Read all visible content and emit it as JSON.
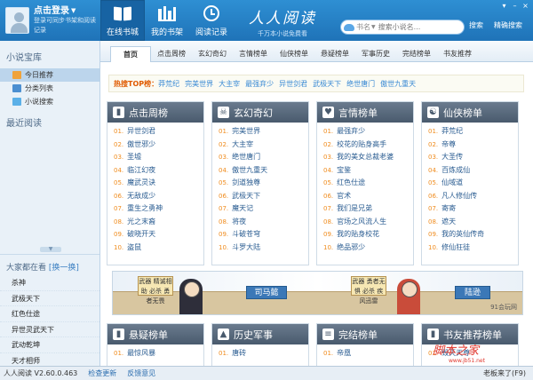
{
  "header": {
    "login": {
      "title": "点击登录",
      "subtitle": "登录可同步书架和阅读记录"
    },
    "tabs": [
      {
        "label": "在线书城",
        "icon": "book-icon"
      },
      {
        "label": "我的书架",
        "icon": "bookshelf-icon"
      },
      {
        "label": "阅读记录",
        "icon": "clock-icon"
      }
    ],
    "brand": {
      "name": "人人阅读",
      "slogan": "千万本小说免费看"
    },
    "search": {
      "category": "书名",
      "placeholder": "搜索小说名...",
      "button": "搜索",
      "precise_button": "精确搜索"
    }
  },
  "sidebar": {
    "title": "小说宝库",
    "menu": [
      {
        "label": "今日推荐"
      },
      {
        "label": "分类列表"
      },
      {
        "label": "小说搜索"
      }
    ],
    "recent_title": "最近阅读",
    "hot_title": "大家都在看",
    "hot_swap": "[换一换]",
    "hot_list": [
      "杀神",
      "武极天下",
      "红色仕途",
      "异世灵武天下",
      "武动乾坤",
      "天才相师"
    ]
  },
  "main": {
    "tabs": [
      "首页",
      "点击周榜",
      "玄幻奇幻",
      "言情榜单",
      "仙侠榜单",
      "悬疑榜单",
      "军事历史",
      "完结榜单",
      "书友推荐"
    ],
    "hot_label": "热搜TOP榜：",
    "hot_links": [
      "莽荒纪",
      "完美世界",
      "大主宰",
      "最强弃少",
      "异世剑君",
      "武极天下",
      "绝世唐门",
      "傲世九重天"
    ],
    "panels": [
      {
        "title": "点击周榜",
        "icon": "bookmark-icon",
        "items": [
          "异世剑君",
          "傲世邪少",
          "圣墟",
          "临江幻夜",
          "魔武灵诀",
          "无敌成少",
          "重生之勇神",
          "光之末裔",
          "破晓开天",
          "盗鼠"
        ]
      },
      {
        "title": "玄幻奇幻",
        "icon": "skull-icon",
        "items": [
          "完美世界",
          "大主宰",
          "绝世唐门",
          "傲世九重天",
          "剑道独尊",
          "武极天下",
          "魔天记",
          "将夜",
          "斗破苍穹",
          "斗罗大陆"
        ]
      },
      {
        "title": "言情榜单",
        "icon": "heart-icon",
        "items": [
          "最强弃少",
          "校花的贴身高手",
          "我的美女总裁老婆",
          "宝鉴",
          "红色仕途",
          "官术",
          "我们是兄弟",
          "官场之风流人生",
          "我的贴身校花",
          "绝品邪少"
        ]
      },
      {
        "title": "仙侠榜单",
        "icon": "taiji-icon",
        "items": [
          "莽荒纪",
          "帝尊",
          "大圣传",
          "百炼成仙",
          "仙域道",
          "凡人修仙传",
          "寄寄",
          "遮天",
          "我的英仙传奇",
          "修仙狂徒"
        ]
      }
    ],
    "banner": {
      "sign_left": "武器 精诚相助 必杀 勇者无畏",
      "name_left": "司马懿",
      "sign_right": "武器 勇者无惧 必杀 疾风迅雷",
      "name_right": "陆逊",
      "mark": "91会玩网"
    },
    "panels2": [
      {
        "title": "悬疑榜单",
        "icon": "bookmark-icon",
        "first": "最惊风暴"
      },
      {
        "title": "历史军事",
        "icon": "rocket-icon",
        "first": "唐砖"
      },
      {
        "title": "完结榜单",
        "icon": "list-icon",
        "first": "帝凰"
      },
      {
        "title": "书友推荐榜单",
        "icon": "bookmark-icon",
        "first": "毁灭天尊"
      }
    ]
  },
  "statusbar": {
    "version": "人人阅读 V2.60.0.463",
    "check_update": "检查更新",
    "feedback": "反馈意见",
    "boss_key": "老板来了(F9)"
  },
  "watermark": {
    "main": "脚本之家",
    "url": "www.jb51.net"
  }
}
